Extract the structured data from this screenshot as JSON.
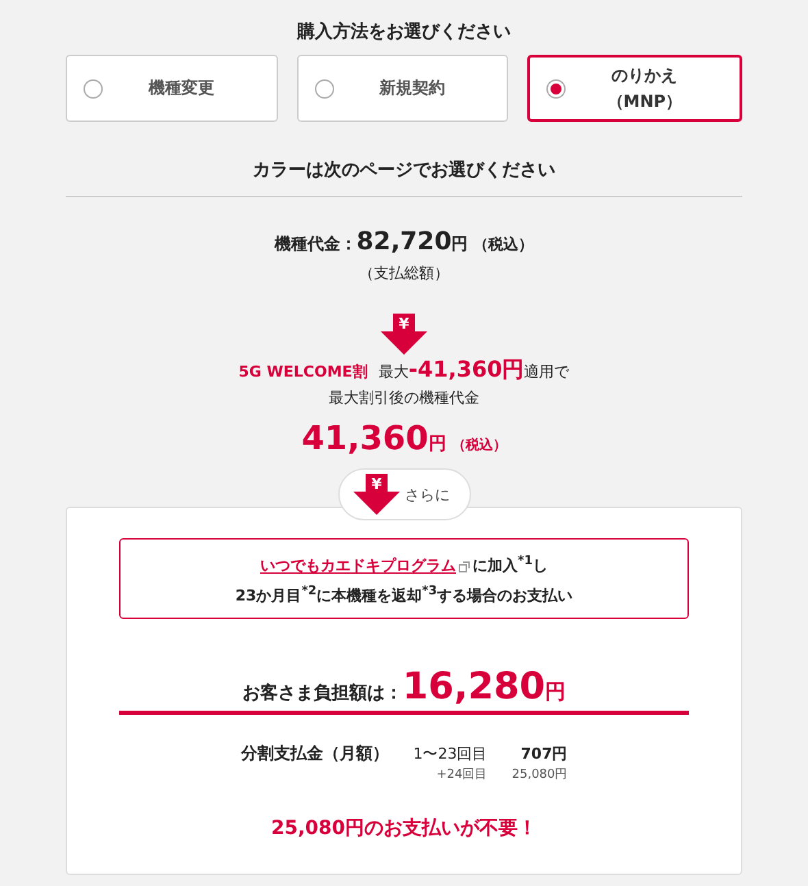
{
  "purchase": {
    "heading": "購入方法をお選びください",
    "options": [
      {
        "lines": [
          "機種変更"
        ],
        "selected": false
      },
      {
        "lines": [
          "新規契約"
        ],
        "selected": false
      },
      {
        "lines": [
          "のりかえ",
          "（MNP）"
        ],
        "selected": true
      }
    ]
  },
  "color_note": "カラーは次のページでお選びください",
  "price": {
    "label": "機種代金：",
    "amount": "82,720",
    "unit": "円",
    "tax": "（税込）",
    "note": "（支払総額）"
  },
  "discount": {
    "arrow_symbol": "¥",
    "name": "5G WELCOME割",
    "prefix": "最大",
    "amount": "-41,360円",
    "suffix": "適用で",
    "caption": "最大割引後の機種代金",
    "result_amount": "41,360",
    "result_unit": "円",
    "result_tax": "（税込）"
  },
  "further": {
    "arrow_symbol": "¥",
    "label": "さらに"
  },
  "program": {
    "link": "いつでもカエドキプログラム",
    "line1_rest": "に加入$^{*1}$し",
    "line2": "23か月目$^{*2}$に本機種を返却$^{*3}$する場合のお支払い"
  },
  "burden": {
    "label": "お客さま負担額は：",
    "amount": "16,280",
    "unit": "円"
  },
  "installment": {
    "label": "分割支払金（月額）",
    "rows": [
      {
        "range": "1〜23回目",
        "amount": "707円",
        "kind": "main"
      },
      {
        "range": "+24回目",
        "amount": "25,080円",
        "kind": "sub"
      }
    ]
  },
  "saving": "25,080円のお支払いが不要！"
}
